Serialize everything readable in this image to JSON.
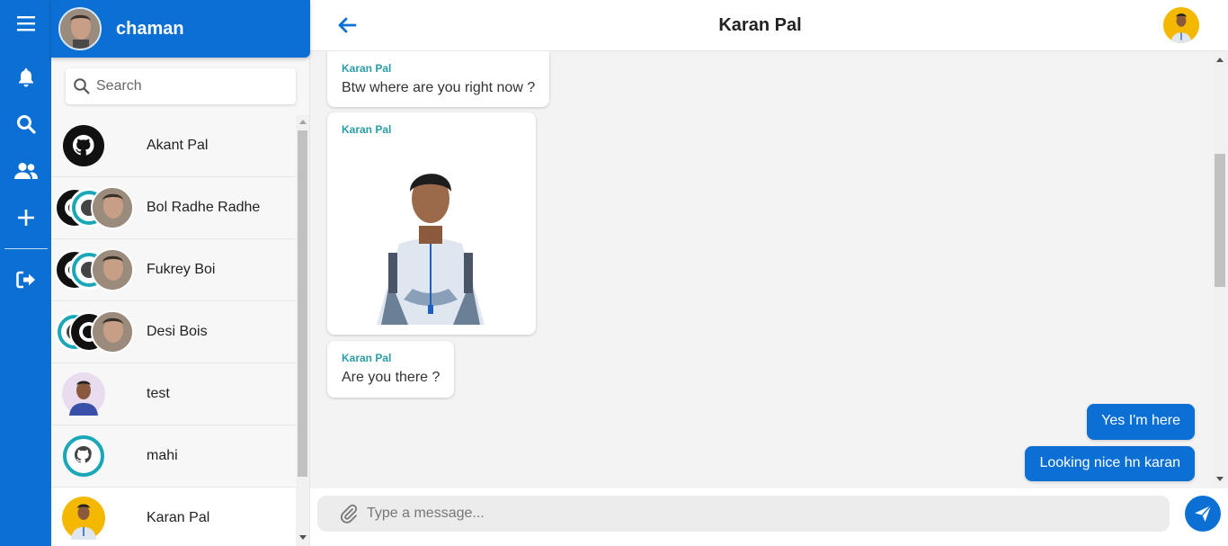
{
  "user": {
    "name": "chaman"
  },
  "search": {
    "placeholder": "Search"
  },
  "contacts": [
    {
      "name": "Akant Pal",
      "avatar": "github-avatar"
    },
    {
      "name": "Bol Radhe Radhe",
      "avatar": "group-avatar"
    },
    {
      "name": "Fukrey Boi",
      "avatar": "group-avatar"
    },
    {
      "name": "Desi Bois",
      "avatar": "group-avatar"
    },
    {
      "name": "test",
      "avatar": "person-avatar"
    },
    {
      "name": "mahi",
      "avatar": "github-avatar"
    },
    {
      "name": "Karan Pal",
      "avatar": "person-avatar"
    }
  ],
  "chat": {
    "title": "Karan Pal",
    "messages_in": [
      {
        "sender": "Karan Pal",
        "text": "Btw where are you right now ?"
      },
      {
        "sender": "Karan Pal",
        "image": "photo"
      },
      {
        "sender": "Karan Pal",
        "text": "Are you there ?"
      }
    ],
    "messages_out": [
      {
        "text": "Yes I'm here"
      },
      {
        "text": "Looking nice hn karan"
      }
    ]
  },
  "composer": {
    "placeholder": "Type a message..."
  },
  "colors": {
    "primary": "#0b6fd3",
    "sender": "#2a9da6"
  }
}
